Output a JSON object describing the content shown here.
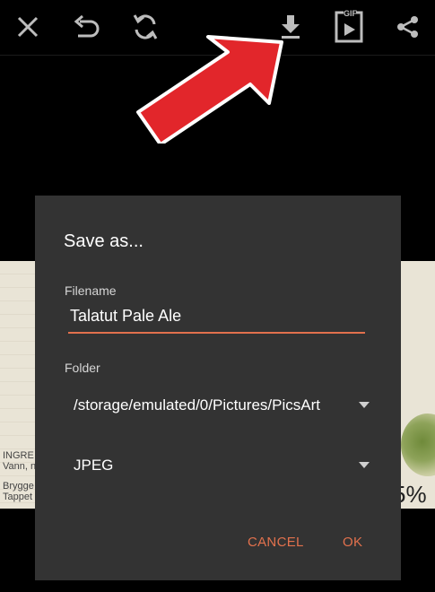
{
  "toolbar": {
    "icons": [
      "close-icon",
      "undo-icon",
      "rotate-icon",
      "download-icon",
      "gif-icon",
      "share-icon"
    ],
    "gif_label": "GIF"
  },
  "background_photo": {
    "text_lines": [
      "INGRE",
      "Vann, n",
      "Brygge",
      "Tappet"
    ],
    "percent_fragment": "5%"
  },
  "dialog": {
    "title": "Save as...",
    "filename_label": "Filename",
    "filename_value": "Talatut Pale Ale",
    "folder_label": "Folder",
    "folder_value": "/storage/emulated/0/Pictures/PicsArt",
    "format_value": "JPEG",
    "cancel_label": "CANCEL",
    "ok_label": "OK"
  },
  "colors": {
    "accent": "#e2714d",
    "dialog_bg": "#333333",
    "annotation_arrow": "#e2262b"
  }
}
